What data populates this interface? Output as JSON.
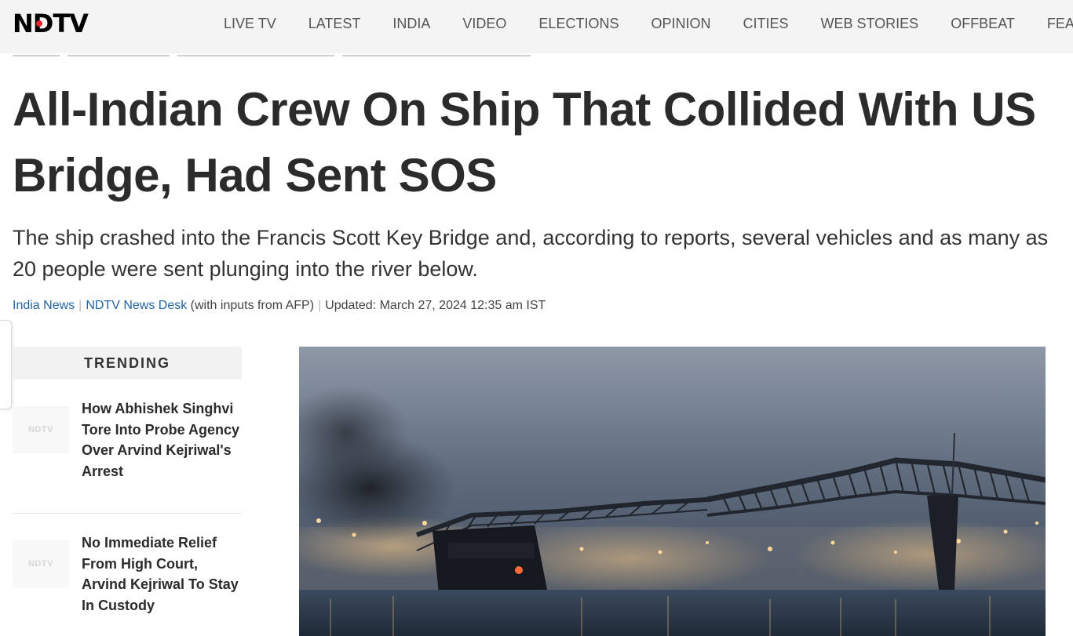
{
  "header": {
    "logo": "NDTV",
    "nav": [
      "LIVE TV",
      "LATEST",
      "INDIA",
      "VIDEO",
      "ELECTIONS",
      "OPINION",
      "CITIES",
      "WEB STORIES",
      "OFFBEAT",
      "FEATU"
    ]
  },
  "article": {
    "headline": "All-Indian Crew On Ship That Collided With US Bridge, Had Sent SOS",
    "summary": "The ship crashed into the Francis Scott Key Bridge and, according to reports, several vehicles and as many as 20 people were sent plunging into the river below.",
    "byline": {
      "category": "India News",
      "author": "NDTV News Desk",
      "inputs": "(with inputs from AFP)",
      "updated": "Updated: March 27, 2024 12:35 am IST"
    }
  },
  "trending": {
    "heading": "TRENDING",
    "thumb_label": "NDTV",
    "items": [
      {
        "title": "How Abhishek Singhvi Tore Into Probe Agency Over Arvind Kejriwal's Arrest"
      },
      {
        "title": "No Immediate Relief From High Court, Arvind Kejriwal To Stay In Custody"
      }
    ]
  },
  "colors": {
    "brand_red": "#e3262c",
    "link_blue": "#2464a0",
    "header_bg": "#f4f4f4"
  }
}
